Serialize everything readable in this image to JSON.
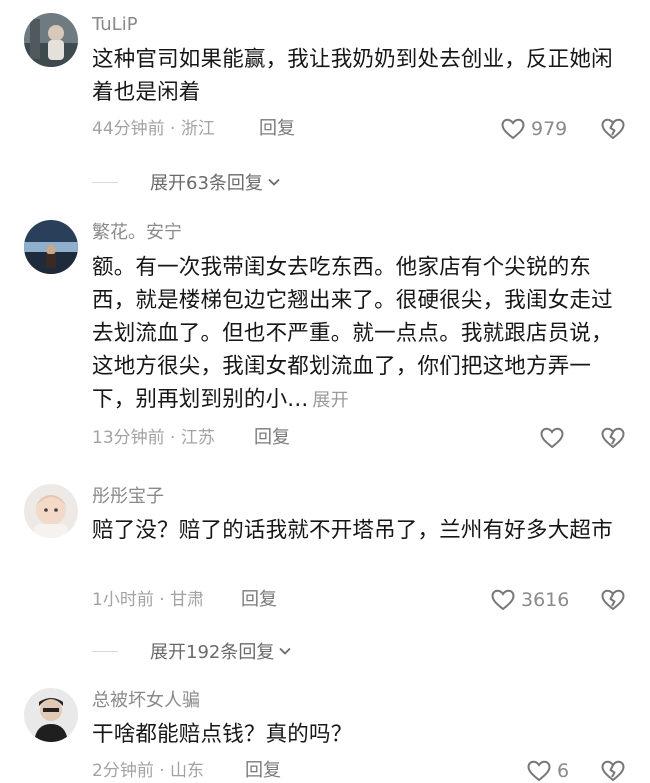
{
  "comments": [
    {
      "username": "TuLiP",
      "text": "这种官司如果能赢，我让我奶奶到处去创业，反正她闲着也是闲着",
      "meta": "44分钟前 · 浙江",
      "reply": "回复",
      "likes": "979",
      "expand": "展开63条回复"
    },
    {
      "username": "繁花。安宁",
      "text": "额。有一次我带闺女去吃东西。他家店有个尖锐的东西，就是楼梯包边它翘出来了。很硬很尖，我闺女走过去划流血了。但也不严重。就一点点。我就跟店员说，这地方很尖，我闺女都划流血了，你们把这地方弄一下，别再划到别的小...",
      "expand_inline": "展开",
      "meta": "13分钟前 · 江苏",
      "reply": "回复",
      "likes": ""
    },
    {
      "username": "彤彤宝子",
      "text": "赔了没？赔了的话我就不开塔吊了，兰州有好多大超市",
      "meta": "1小时前 · 甘肃",
      "reply": "回复",
      "likes": "3616",
      "expand": "展开192条回复"
    },
    {
      "username": "总被坏女人骗",
      "text": "干啥都能赔点钱？真的吗？",
      "meta": "2分钟前 · 山东",
      "reply": "回复",
      "likes": "6"
    }
  ],
  "icons": {
    "like": "heart-outline-icon",
    "dislike": "broken-heart-icon",
    "expand": "chevron-down-icon"
  }
}
